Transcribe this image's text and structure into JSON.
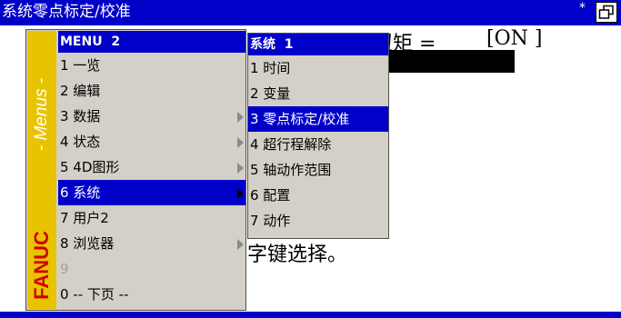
{
  "titlebar": {
    "title": "系统零点标定/校准",
    "mark": "*",
    "window_button_icon": "restore-window-icon"
  },
  "background": {
    "line1": "扭矩 =",
    "line1_value": "[ON ]",
    "instruction": "字键选择。"
  },
  "menu_strip": {
    "menus_label": "- Menus -",
    "brand": "FANUC"
  },
  "menu": {
    "header": "MENU  2",
    "items": [
      {
        "label": "1 一览"
      },
      {
        "label": "2 编辑"
      },
      {
        "label": "3 数据"
      },
      {
        "label": "4 状态"
      },
      {
        "label": "5 4D图形"
      },
      {
        "label": "6 系统"
      },
      {
        "label": "7 用户2"
      },
      {
        "label": "8 浏览器"
      },
      {
        "label": "9"
      },
      {
        "label": "0 -- 下页 --"
      }
    ]
  },
  "submenu": {
    "header": "系统  1",
    "items": [
      {
        "label": "1 时间"
      },
      {
        "label": "2 变量"
      },
      {
        "label": "3 零点标定/校准"
      },
      {
        "label": "4 超行程解除"
      },
      {
        "label": "5 轴动作范围"
      },
      {
        "label": "6 配置"
      },
      {
        "label": "7 动作"
      }
    ]
  },
  "colors": {
    "titlebar": "#0000c8",
    "selection": "#0000c8",
    "menu_bg": "#d4d0c8",
    "strip": "#e8c400",
    "brand": "#d00000"
  }
}
